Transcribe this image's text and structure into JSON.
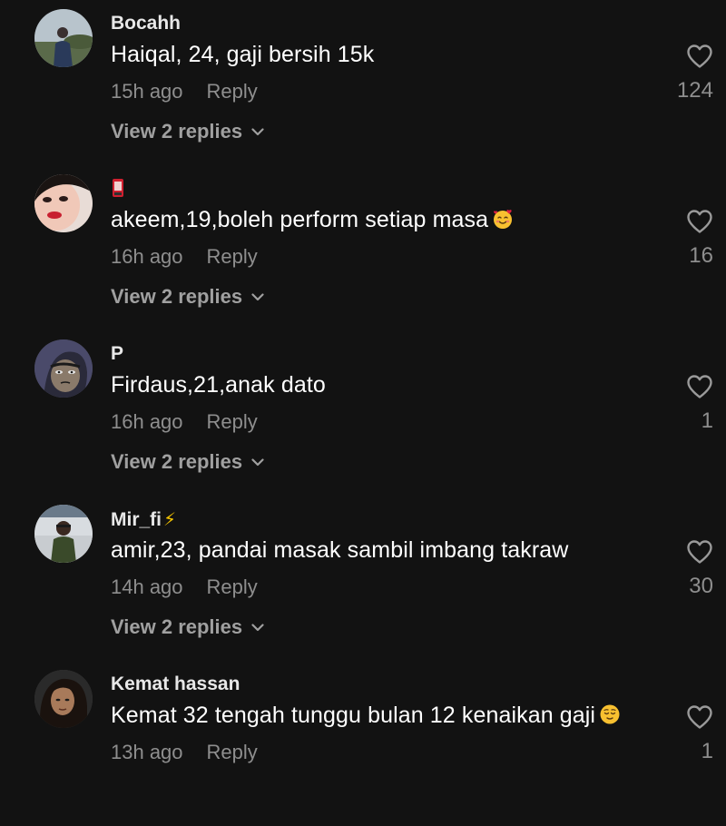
{
  "comments": [
    {
      "username": "Bocahh",
      "text": "Haiqal, 24, gaji bersih 15k",
      "time": "15h ago",
      "reply_label": "Reply",
      "view_replies": "View 2 replies",
      "likes": "124",
      "avatar": "man-standing-outdoors-photo"
    },
    {
      "username": "",
      "username_icon": "phone-icon",
      "text": "akeem,19,boleh perform setiap masa",
      "emoji": "smiling-face-with-hearts",
      "time": "16h ago",
      "reply_label": "Reply",
      "view_replies": "View 2 replies",
      "likes": "16",
      "avatar": "woman-face-closeup-photo"
    },
    {
      "username": "P",
      "text": "Firdaus,21,anak dato",
      "time": "16h ago",
      "reply_label": "Reply",
      "view_replies": "View 2 replies",
      "likes": "1",
      "avatar": "cartoon-face-illustration"
    },
    {
      "username": "Mir_fi",
      "username_badge": "⚡",
      "text": "amir,23, pandai masak sambil imbang takraw",
      "time": "14h ago",
      "reply_label": "Reply",
      "view_replies": "View 2 replies",
      "likes": "30",
      "avatar": "man-in-stadium-photo"
    },
    {
      "username": "Kemat hassan",
      "text": "Kemat 32 tengah tunggu bulan 12 kenaikan gaji",
      "emoji": "relieved-face",
      "time": "13h ago",
      "reply_label": "Reply",
      "view_replies": "",
      "likes": "1",
      "avatar": "man-long-hair-photo"
    }
  ],
  "colors": {
    "background": "#121212",
    "primary_text": "#ffffff",
    "secondary_text": "#8e8e8e",
    "badge": "#f5c400"
  }
}
